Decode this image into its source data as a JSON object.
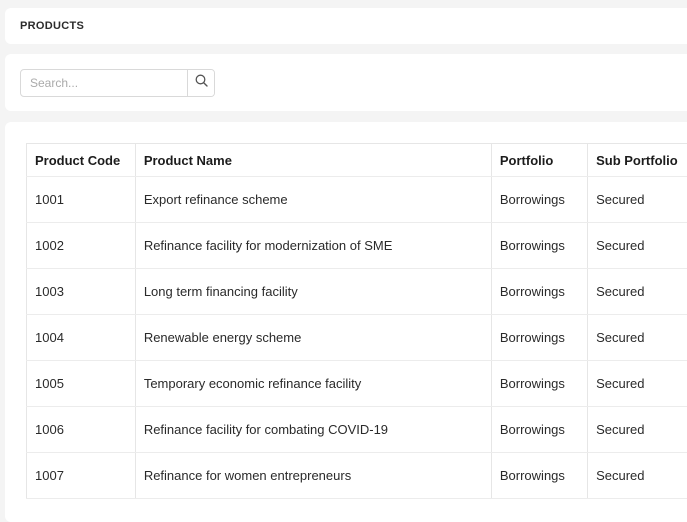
{
  "header": {
    "title": "PRODUCTS"
  },
  "search": {
    "placeholder": "Search..."
  },
  "table": {
    "columns": [
      "Product Code",
      "Product Name",
      "Portfolio",
      "Sub Portfolio"
    ],
    "rows": [
      [
        "1001",
        "Export refinance scheme",
        "Borrowings",
        "Secured"
      ],
      [
        "1002",
        "Refinance facility for modernization of SME",
        "Borrowings",
        "Secured"
      ],
      [
        "1003",
        "Long term financing facility",
        "Borrowings",
        "Secured"
      ],
      [
        "1004",
        "Renewable energy scheme",
        "Borrowings",
        "Secured"
      ],
      [
        "1005",
        "Temporary economic refinance facility",
        "Borrowings",
        "Secured"
      ],
      [
        "1006",
        "Refinance facility for combating COVID-19",
        "Borrowings",
        "Secured"
      ],
      [
        "1007",
        "Refinance for women entrepreneurs",
        "Borrowings",
        "Secured"
      ]
    ]
  }
}
